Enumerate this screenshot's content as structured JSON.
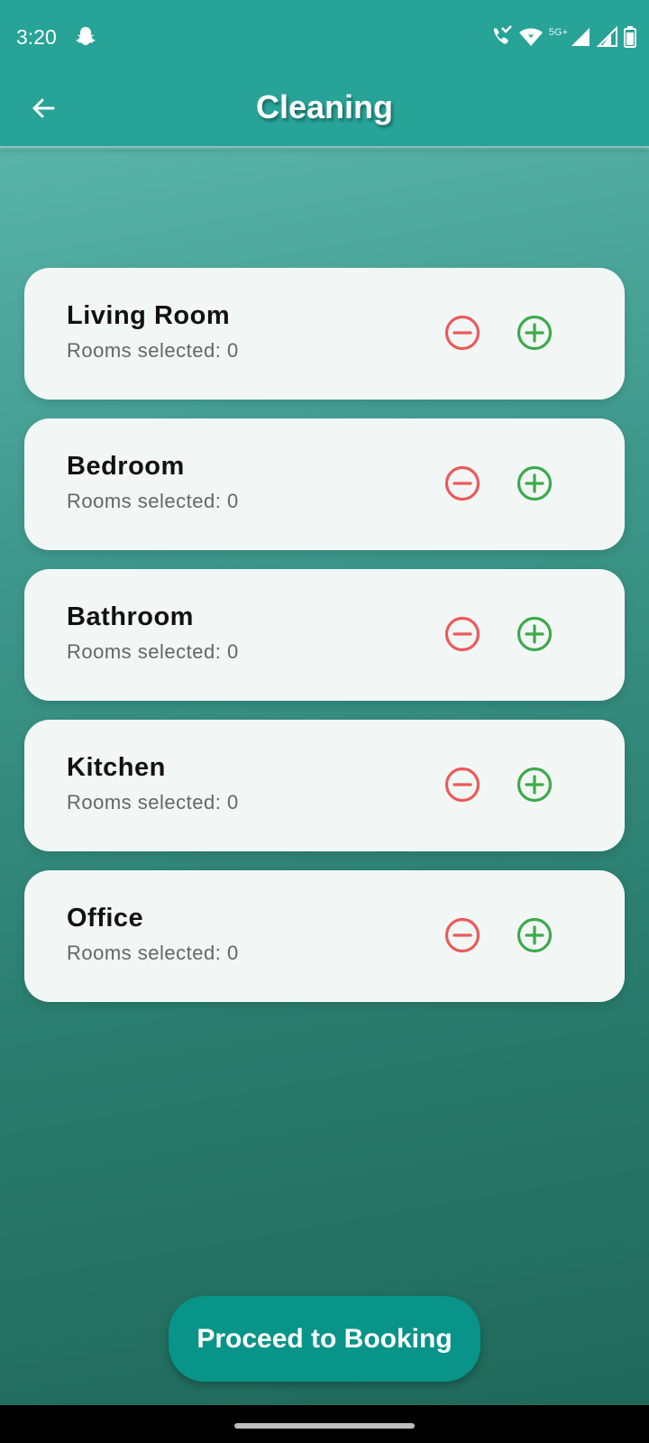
{
  "status_bar": {
    "time": "3:20",
    "network_label": "5G+",
    "icons": [
      "snapchat-icon",
      "wifi-calling-icon",
      "wifi-icon",
      "signal-icon",
      "signal-icon",
      "battery-icon"
    ]
  },
  "app_bar": {
    "title": "Cleaning",
    "back_icon": "arrow-left-icon"
  },
  "rooms": [
    {
      "name": "Living Room",
      "count_label": "Rooms selected: 0",
      "count": 0
    },
    {
      "name": "Bedroom",
      "count_label": "Rooms selected: 0",
      "count": 0
    },
    {
      "name": "Bathroom",
      "count_label": "Rooms selected: 0",
      "count": 0
    },
    {
      "name": "Kitchen",
      "count_label": "Rooms selected: 0",
      "count": 0
    },
    {
      "name": "Office",
      "count_label": "Rooms selected: 0",
      "count": 0
    }
  ],
  "actions": {
    "proceed_label": "Proceed to Booking"
  },
  "colors": {
    "accent": "#27a397",
    "minus": "#ec5a5a",
    "plus": "#3daa4b",
    "button": "#089488"
  }
}
